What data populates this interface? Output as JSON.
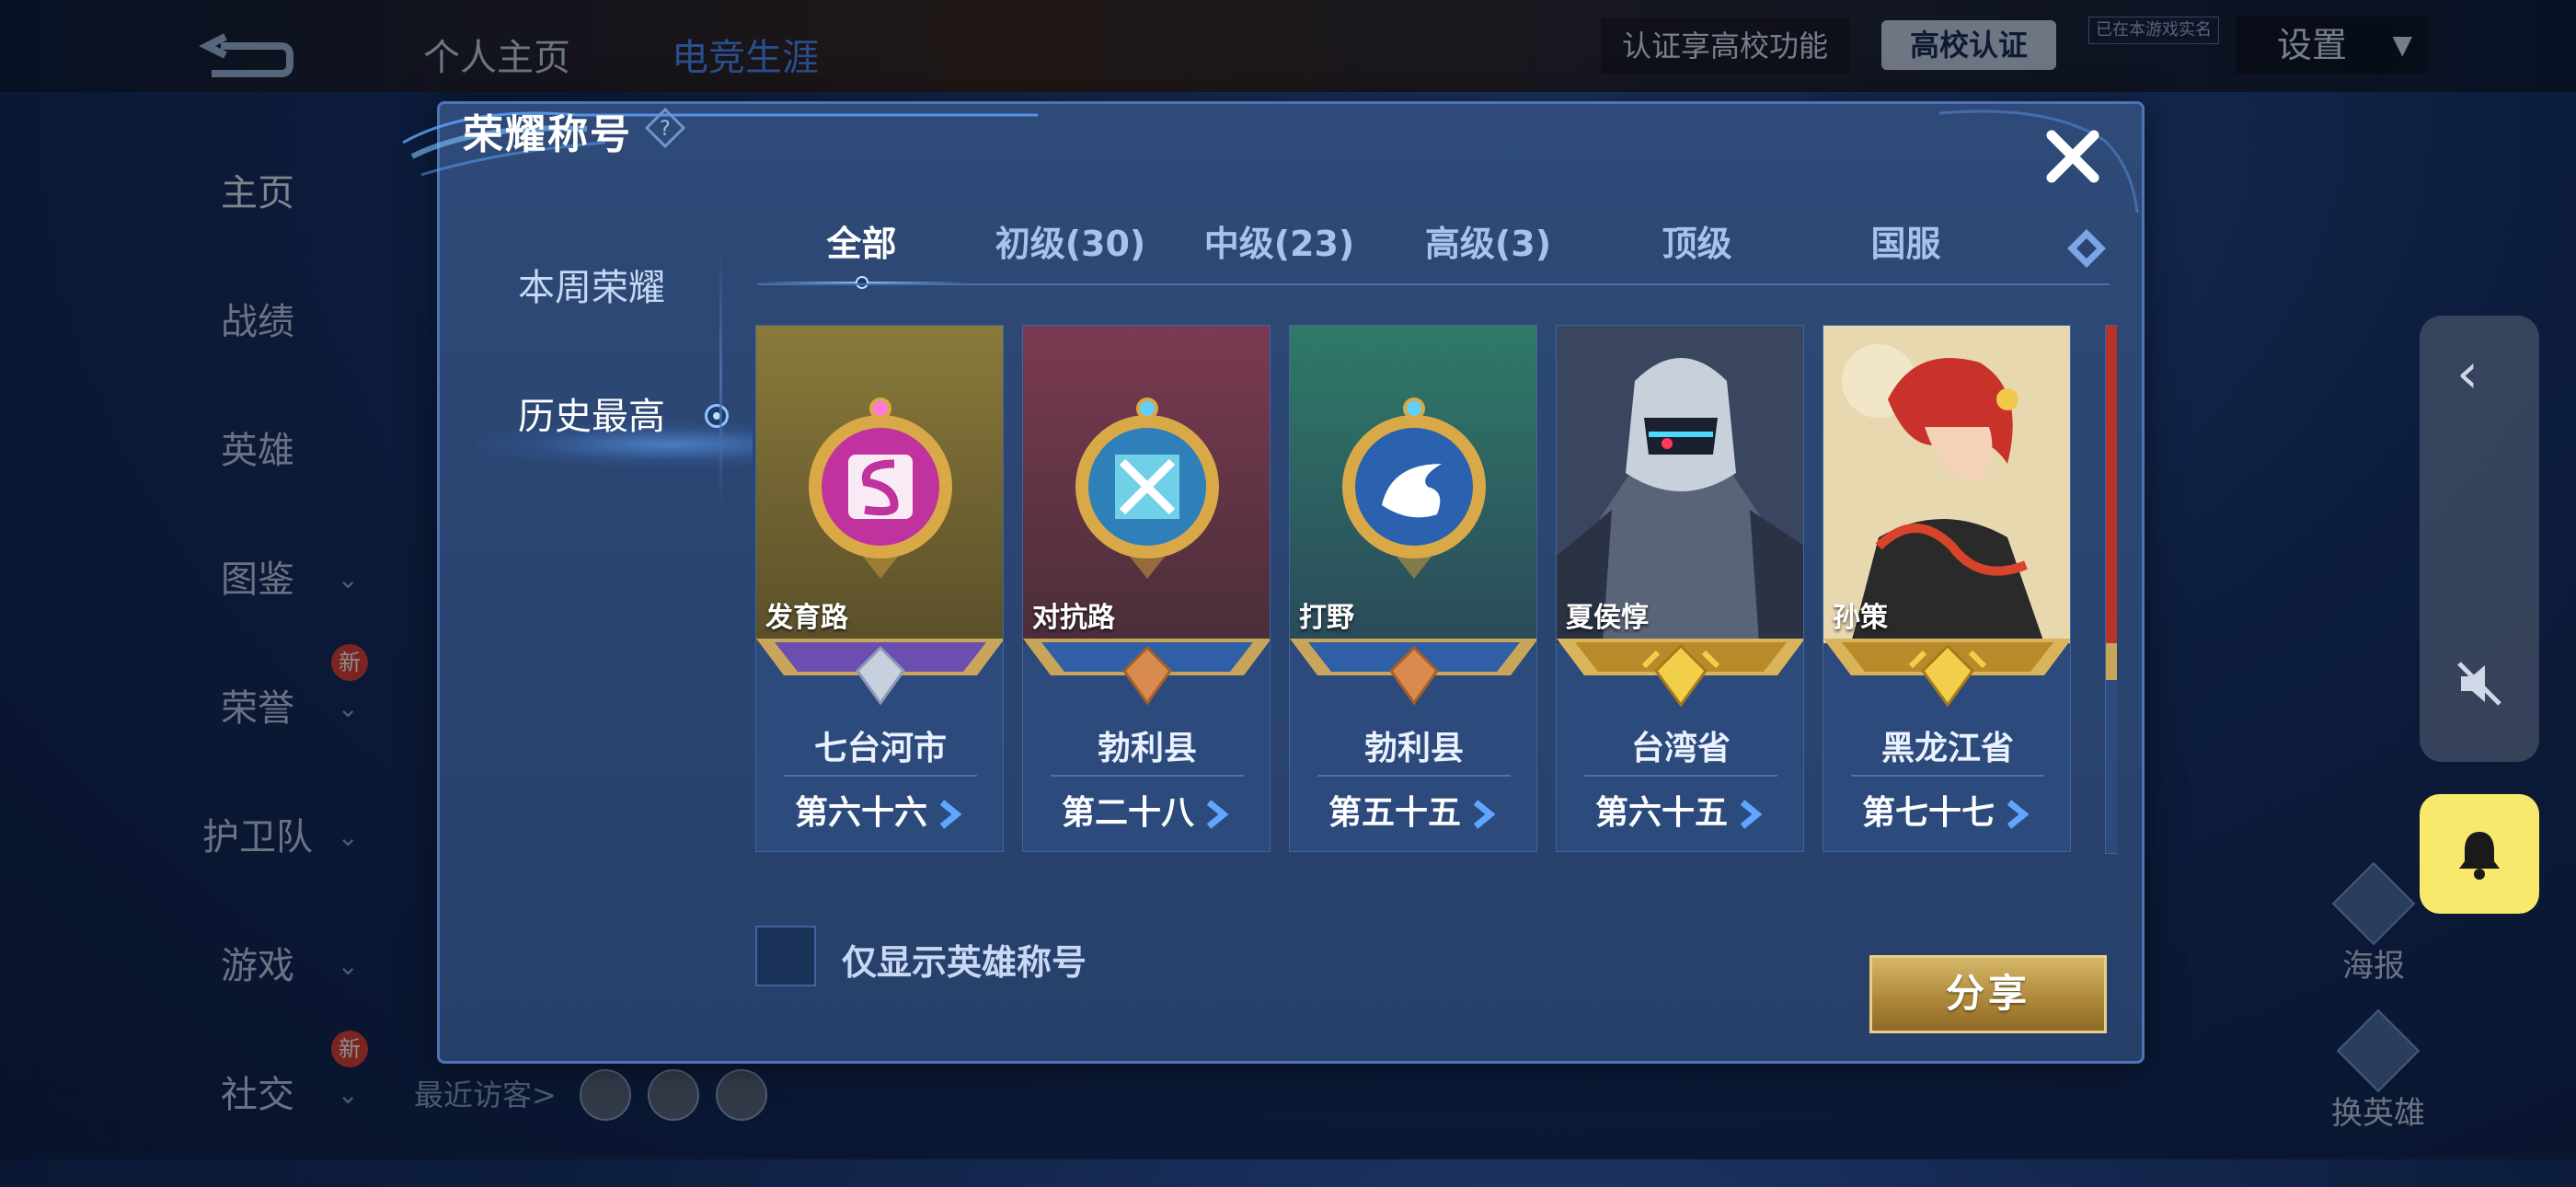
{
  "background": {
    "top_tabs": [
      "个人主页",
      "电竞生涯"
    ],
    "cert_text": "认证享高校功能",
    "cert_button": "高校认证",
    "safe_tag": "已在本游戏实名",
    "settings": "设置",
    "nav": [
      {
        "label": "主页",
        "chevron": false,
        "new": false
      },
      {
        "label": "战绩",
        "chevron": false,
        "new": false
      },
      {
        "label": "英雄",
        "chevron": false,
        "new": false
      },
      {
        "label": "图鉴",
        "chevron": true,
        "new": false
      },
      {
        "label": "荣誉",
        "chevron": true,
        "new": true
      },
      {
        "label": "护卫队",
        "chevron": true,
        "new": false
      },
      {
        "label": "游戏",
        "chevron": true,
        "new": false
      },
      {
        "label": "社交",
        "chevron": true,
        "new": true
      }
    ],
    "new_badge": "新",
    "recent_visitors": "最近访客>",
    "poster": "海报",
    "swap_hero": "换英雄"
  },
  "modal": {
    "title": "荣耀称号",
    "side_tabs": [
      "本周荣耀",
      "历史最高"
    ],
    "active_side_tab": 1,
    "tabs": [
      "全部",
      "初级(30)",
      "中级(23)",
      "高级(3)",
      "顶级",
      "国服"
    ],
    "active_tab": 0,
    "cards": [
      {
        "label": "发育路",
        "city": "七台河市",
        "place": "第六十六",
        "rank": "silver",
        "art": "marksman"
      },
      {
        "label": "对抗路",
        "city": "勃利县",
        "place": "第二十八",
        "rank": "bronze",
        "art": "fighter"
      },
      {
        "label": "打野",
        "city": "勃利县",
        "place": "第五十五",
        "rank": "bronze",
        "art": "jungle"
      },
      {
        "label": "夏侯惇",
        "city": "台湾省",
        "place": "第六十五",
        "rank": "gold",
        "art": "hero-mech"
      },
      {
        "label": "孙策",
        "city": "黑龙江省",
        "place": "第七十七",
        "rank": "gold",
        "art": "hero-redhair"
      }
    ],
    "checkbox_label": "仅显示英雄称号",
    "checkbox_checked": false,
    "share_label": "分享"
  },
  "colors": {
    "accent": "#7fc4ff",
    "share_gold": "#c9a24e",
    "bell_yellow": "#f6e96b"
  }
}
